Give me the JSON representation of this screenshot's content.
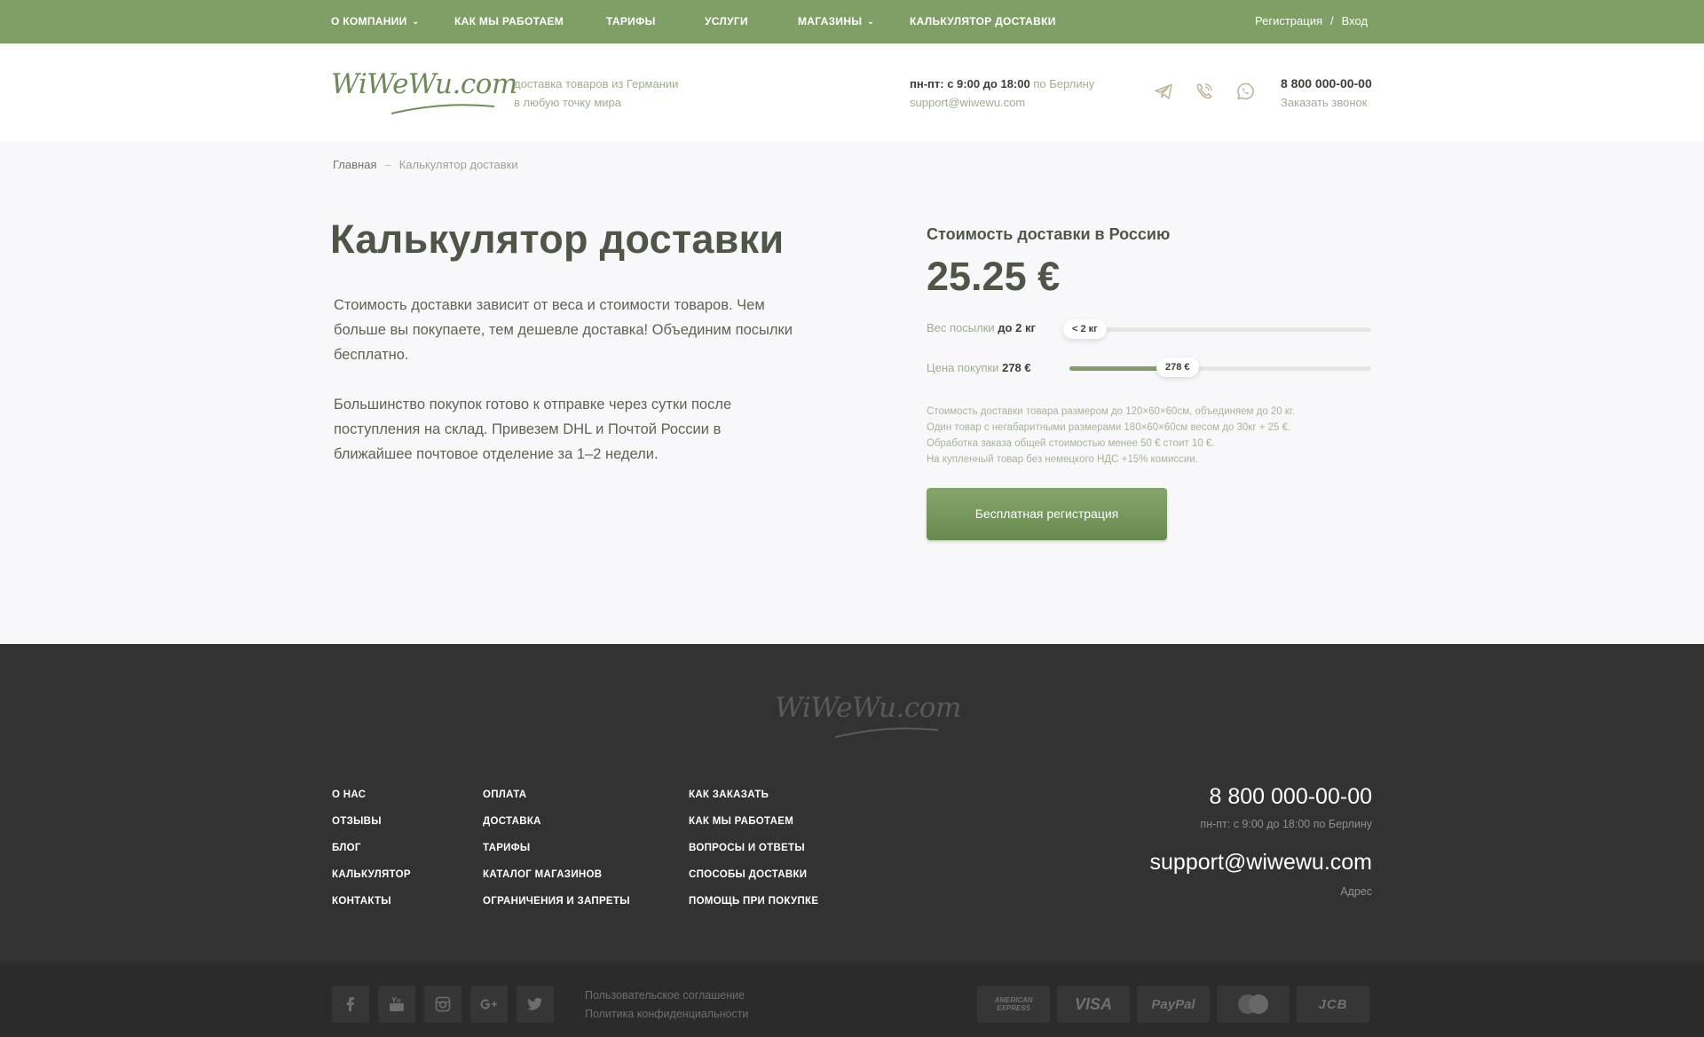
{
  "nav": {
    "items": [
      {
        "label": "О КОМПАНИИ",
        "dropdown": true
      },
      {
        "label": "КАК МЫ РАБОТАЕМ",
        "dropdown": false
      },
      {
        "label": "ТАРИФЫ",
        "dropdown": false
      },
      {
        "label": "УСЛУГИ",
        "dropdown": false
      },
      {
        "label": "МАГАЗИНЫ",
        "dropdown": true
      },
      {
        "label": "КАЛЬКУЛЯТОР ДОСТАВКИ",
        "dropdown": false
      }
    ],
    "register": "Регистрация",
    "separator": "/",
    "login": "Вход"
  },
  "header": {
    "logo": "WiWeWu.com",
    "tagline_line1": "доставка товаров из Германии",
    "tagline_line2": "в любую точку мира",
    "hours_bold": "пн-пт: с 9:00 до 18:00",
    "hours_suffix": " по Берлину",
    "email": "support@wiwewu.com",
    "phone": "8 800 000-00-00",
    "callback": "Заказать звонок",
    "social_icons": [
      "telegram-icon",
      "viber-icon",
      "whatsapp-icon"
    ]
  },
  "breadcrumb": {
    "home": "Главная",
    "separator": "–",
    "current": "Калькулятор доставки"
  },
  "main": {
    "title": "Калькулятор доставки",
    "para1": "Стоимость доставки зависит от веса и стоимости товаров. Чем больше вы покупаете, тем дешевле доставка! Объединим посылки бесплатно.",
    "para2": "Большинство покупок готово к отправке через сутки после поступления на склад. Привезем DHL и Почтой России в ближайшее почтовое отделение за 1–2 недели."
  },
  "calculator": {
    "title": "Стоимость доставки в Россию",
    "price": "25.25 €",
    "weight_label": "Вес посылки",
    "weight_value": "до 2 кг",
    "weight_thumb": "< 2 кг",
    "weight_fraction": 0.0,
    "price_label": "Цена покупки",
    "price_value": "278 €",
    "price_thumb": "278 €",
    "price_fraction": 0.3,
    "note": "Стоимость доставки товара размером до 120×60×60см, объединяем до 20 кг. Один товар с негабаритными размерами 180×60×60см весом до 30кг + 25 €. Обработка заказа общей стоимостью менее 50 € стоит 10 €.",
    "note2": "На купленный товар без немецкого НДС +15% комиссии.",
    "button": "Бесплатная регистрация"
  },
  "footer": {
    "logo": "WiWeWu.com",
    "col1": [
      "О НАС",
      "ОТЗЫВЫ",
      "БЛОГ",
      "КАЛЬКУЛЯТОР",
      "КОНТАКТЫ"
    ],
    "col2": [
      "ОПЛАТА",
      "ДОСТАВКА",
      "ТАРИФЫ",
      "КАТАЛОГ МАГАЗИНОВ",
      "ОГРАНИЧЕНИЯ И ЗАПРЕТЫ"
    ],
    "col3": [
      "КАК ЗАКАЗАТЬ",
      "КАК МЫ РАБОТАЕМ",
      "ВОПРОСЫ И ОТВЕТЫ",
      "СПОСОБЫ ДОСТАВКИ",
      "ПОМОЩЬ ПРИ ПОКУПКЕ"
    ],
    "phone": "8 800 000-00-00",
    "hours": "пн-пт: с 9:00 до 18:00 по Берлину",
    "email": "support@wiwewu.com",
    "address": "Адрес",
    "social_icons": [
      "facebook-icon",
      "youtube-icon",
      "instagram-icon",
      "google-plus-icon",
      "twitter-icon"
    ],
    "legal1": "Пользовательское соглашение",
    "legal2": "Политика конфиденциальности",
    "payments": [
      "AMERICAN EXPRESS",
      "VISA",
      "PayPal",
      "MasterCard",
      "JCB"
    ]
  },
  "colors": {
    "accent": "#7f9f67",
    "footer_bg": "#323232",
    "text_dark": "#4f5547"
  }
}
